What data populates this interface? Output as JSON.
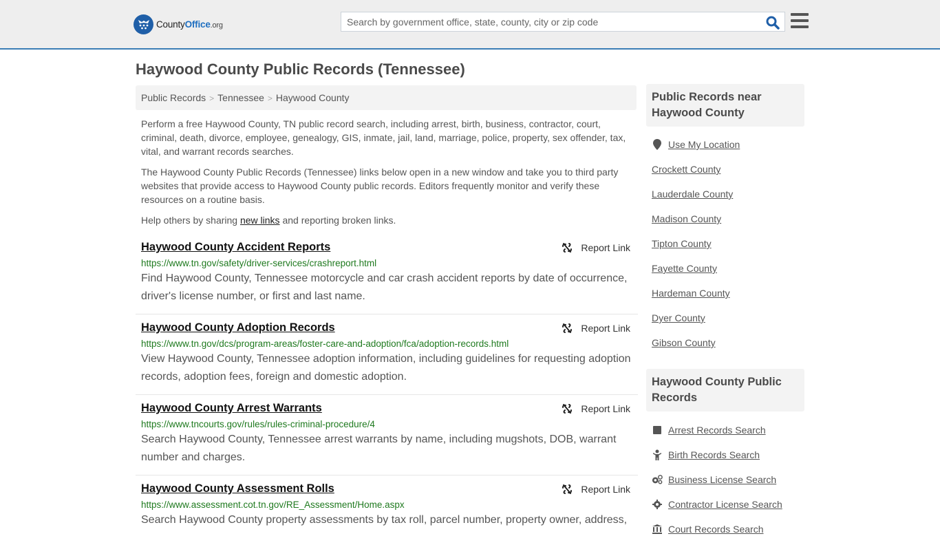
{
  "header": {
    "logo": {
      "prefix": "County",
      "brand": "Office",
      "suffix": ".org"
    },
    "search": {
      "placeholder": "Search by government office, state, county, city or zip code",
      "value": ""
    },
    "colors": {
      "accent": "#3a7db5",
      "brand": "#1f5fa8"
    }
  },
  "page": {
    "title": "Haywood County Public Records (Tennessee)"
  },
  "breadcrumb": [
    {
      "label": "Public Records"
    },
    {
      "label": "Tennessee"
    },
    {
      "label": "Haywood County"
    }
  ],
  "breadcrumb_separator": ">",
  "intro": {
    "p1": "Perform a free Haywood County, TN public record search, including arrest, birth, business, contractor, court, criminal, death, divorce, employee, genealogy, GIS, inmate, jail, land, marriage, police, property, sex offender, tax, vital, and warrant records searches.",
    "p2": "The Haywood County Public Records (Tennessee) links below open in a new window and take you to third party websites that provide access to Haywood County public records. Editors frequently monitor and verify these resources on a routine basis.",
    "p3_before": "Help others by sharing ",
    "p3_link": "new links",
    "p3_after": " and reporting broken links."
  },
  "records": [
    {
      "title": "Haywood County Accident Reports",
      "url": "https://www.tn.gov/safety/driver-services/crashreport.html",
      "description": "Find Haywood County, Tennessee motorcycle and car crash accident reports by date of occurrence, driver's license number, or first and last name.",
      "report_label": "Report Link"
    },
    {
      "title": "Haywood County Adoption Records",
      "url": "https://www.tn.gov/dcs/program-areas/foster-care-and-adoption/fca/adoption-records.html",
      "description": "View Haywood County, Tennessee adoption information, including guidelines for requesting adoption records, adoption fees, foreign and domestic adoption.",
      "report_label": "Report Link"
    },
    {
      "title": "Haywood County Arrest Warrants",
      "url": "https://www.tncourts.gov/rules/rules-criminal-procedure/4",
      "description": "Search Haywood County, Tennessee arrest warrants by name, including mugshots, DOB, warrant number and charges.",
      "report_label": "Report Link"
    },
    {
      "title": "Haywood County Assessment Rolls",
      "url": "https://www.assessment.cot.tn.gov/RE_Assessment/Home.aspx",
      "description": "Search Haywood County property assessments by tax roll, parcel number, property owner, address,",
      "report_label": "Report Link"
    }
  ],
  "sidebar": {
    "nearby": {
      "heading": "Public Records near Haywood County",
      "use_location": "Use My Location",
      "counties": [
        "Crockett County",
        "Lauderdale County",
        "Madison County",
        "Tipton County",
        "Fayette County",
        "Hardeman County",
        "Dyer County",
        "Gibson County"
      ]
    },
    "county_records": {
      "heading": "Haywood County Public Records",
      "items": [
        {
          "label": "Arrest Records Search",
          "icon": "square-icon"
        },
        {
          "label": "Birth Records Search",
          "icon": "child-icon"
        },
        {
          "label": "Business License Search",
          "icon": "cogs-icon"
        },
        {
          "label": "Contractor License Search",
          "icon": "gear-icon"
        },
        {
          "label": "Court Records Search",
          "icon": "courthouse-icon"
        }
      ]
    }
  }
}
